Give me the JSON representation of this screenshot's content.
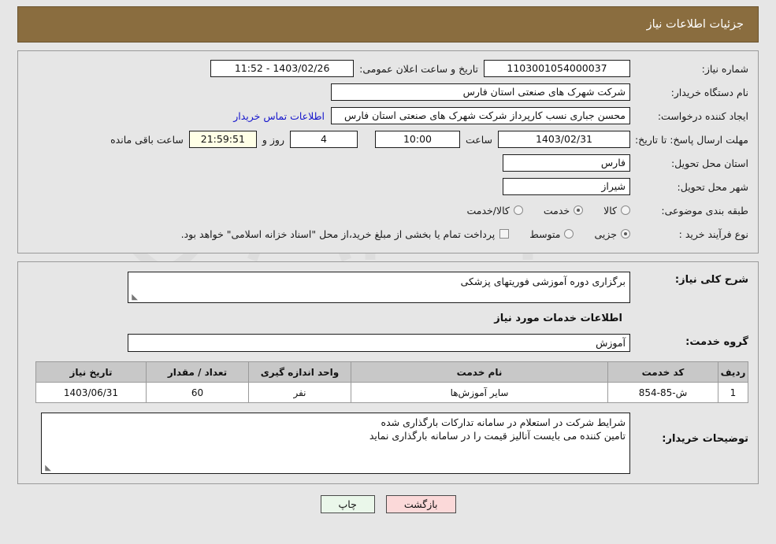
{
  "header": {
    "title": "جزئیات اطلاعات نیاز",
    "bar_color": "#8a6d3f",
    "text_color": "#ffffff"
  },
  "top_panel": {
    "need_number": {
      "label": "شماره نیاز:",
      "value": "1103001054000037"
    },
    "public_announcement": {
      "label": "تاریخ و ساعت اعلان عمومی:",
      "value": "1403/02/26 - 11:52"
    },
    "buyer_org": {
      "label": "نام دستگاه خریدار:",
      "value": "شرکت شهرک های صنعتی استان فارس"
    },
    "request_creator": {
      "label": "ایجاد کننده درخواست:",
      "value": "محسن  جباری نسب کارپرداز شرکت شهرک های صنعتی استان فارس",
      "contact_link": "اطلاعات تماس خریدار"
    },
    "response_deadline": {
      "label": "مهلت ارسال پاسخ: تا تاریخ:",
      "date": "1403/02/31",
      "time_label": "ساعت",
      "time": "10:00",
      "days_remaining": "4",
      "days_label": "روز و",
      "clock_remaining": "21:59:51",
      "remaining_label": "ساعت باقی مانده",
      "clock_background": "#ffffe6"
    },
    "delivery_province": {
      "label": "استان محل تحویل:",
      "value": "فارس"
    },
    "delivery_city": {
      "label": "شهر محل تحویل:",
      "value": "شیراز"
    },
    "subject_category": {
      "label": "طبقه بندی موضوعی:",
      "options": [
        {
          "label": "کالا",
          "selected": false
        },
        {
          "label": "خدمت",
          "selected": true
        },
        {
          "label": "کالا/خدمت",
          "selected": false
        }
      ]
    },
    "purchase_process": {
      "label": "نوع فرآیند خرید :",
      "options": [
        {
          "label": "جزیی",
          "selected": true
        },
        {
          "label": "متوسط",
          "selected": false
        }
      ],
      "treasury_checkbox_checked": false,
      "treasury_note": "پرداخت تمام یا بخشی از مبلغ خرید،از محل \"اسناد خزانه اسلامی\" خواهد بود."
    }
  },
  "mid_panel": {
    "general_description": {
      "label": "شرح کلی نیاز:",
      "value": "برگزاری دوره آموزشی فوریتهای پزشکی"
    },
    "services_section_title": "اطلاعات خدمات مورد نیاز",
    "service_group": {
      "label": "گروه خدمت:",
      "value": "آموزش"
    },
    "items_table": {
      "columns": [
        "ردیف",
        "کد خدمت",
        "نام خدمت",
        "واحد اندازه گیری",
        "تعداد / مقدار",
        "تاریخ نیاز"
      ],
      "rows": [
        {
          "index": "1",
          "code": "ش-85-854",
          "name": "سایر آموزش‌ها",
          "unit": "نفر",
          "quantity": "60",
          "need_date": "1403/06/31"
        }
      ]
    },
    "buyer_notes": {
      "label": "توضیحات خریدار:",
      "line1": "شرایط شرکت در استعلام در سامانه تدارکات بارگذاری شده",
      "line2": "تامین کننده می بایست آنالیز قیمت را در سامانه بارگذاری نماید"
    }
  },
  "footer": {
    "print_button": "چاپ",
    "back_button": "بازگشت",
    "print_color": "#eaf7ea",
    "back_color": "#fbd9d9"
  },
  "watermark": {
    "text": "AriaTender.net"
  }
}
